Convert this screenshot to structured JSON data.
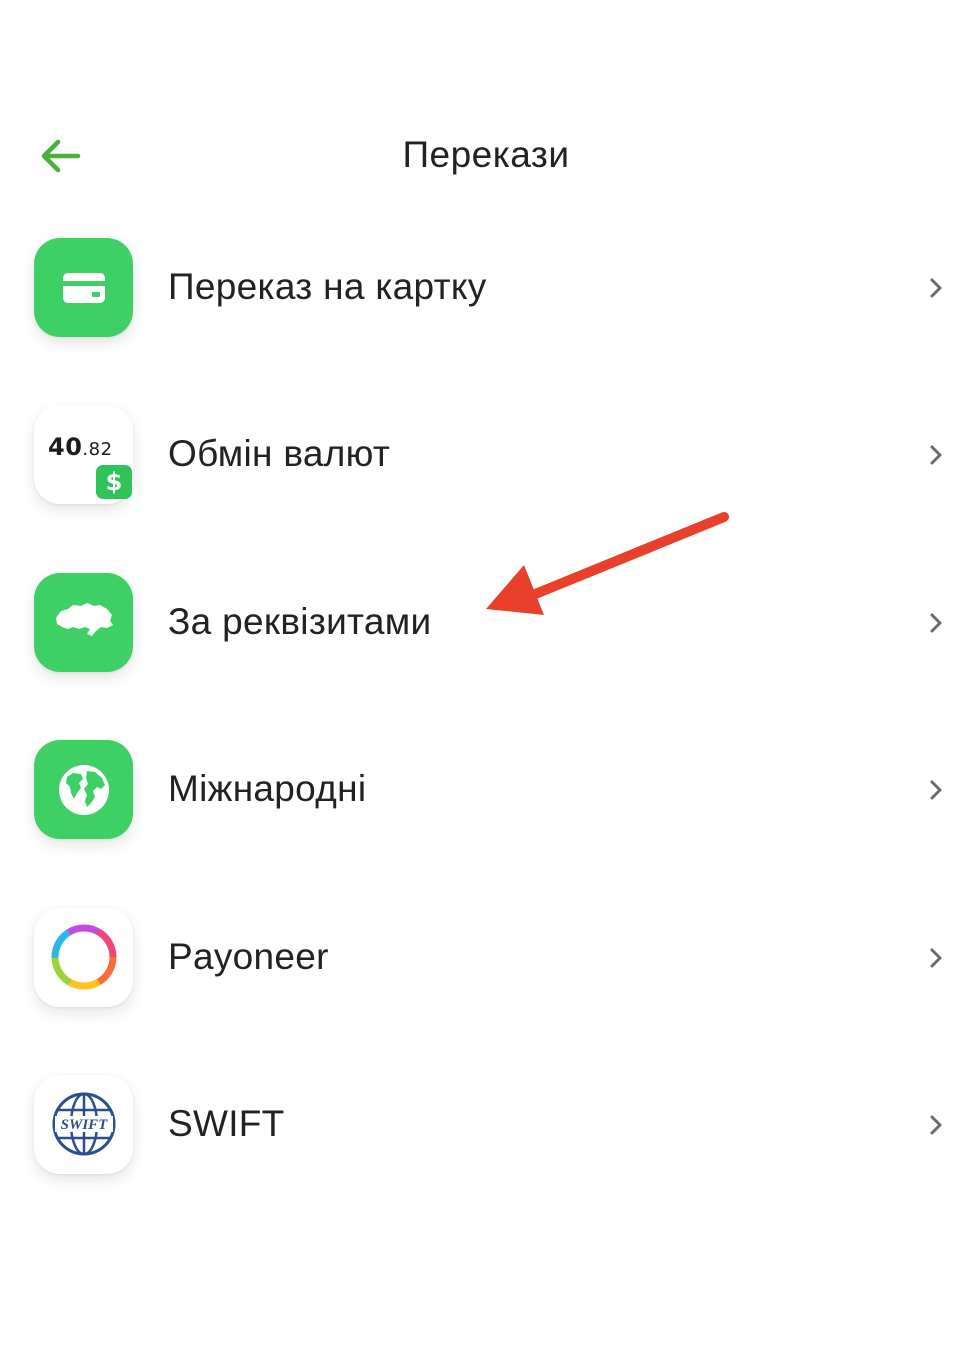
{
  "header": {
    "title": "Перекази",
    "back_icon": "arrow-left-icon"
  },
  "colors": {
    "accent": "#4caf3b",
    "tile_green": "#3fd065",
    "annotation_arrow": "#e8402a"
  },
  "items": [
    {
      "label": "Переказ на картку",
      "icon": "card-icon"
    },
    {
      "label": "Обмін валют",
      "icon": "currency-exchange-icon",
      "rate_main": "40",
      "rate_fraction": ".82",
      "badge": "$"
    },
    {
      "label": "За реквізитами",
      "icon": "ukraine-map-icon"
    },
    {
      "label": "Міжнародні",
      "icon": "globe-icon"
    },
    {
      "label": "Payoneer",
      "icon": "payoneer-ring-icon"
    },
    {
      "label": "SWIFT",
      "icon": "swift-globe-icon",
      "logo_text": "SWIFT"
    }
  ]
}
